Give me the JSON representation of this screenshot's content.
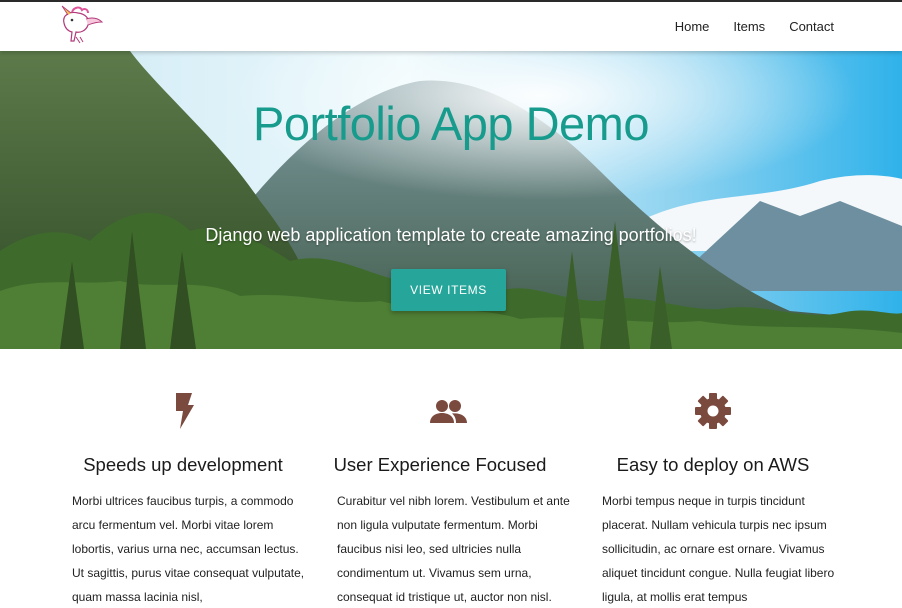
{
  "navbar": {
    "logo_icon": "unicorn-logo-icon",
    "links": [
      "Home",
      "Items",
      "Contact"
    ]
  },
  "hero": {
    "title": "Portfolio App Demo",
    "subtitle": "Django web application template to create amazing portfolios!",
    "button_label": "VIEW ITEMS",
    "title_color": "#179b8c",
    "button_color": "#26a69a"
  },
  "features": [
    {
      "icon": "flash-icon",
      "title": "Speeds up development",
      "text": "Morbi ultrices faucibus turpis, a commodo arcu fermentum vel. Morbi vitae lorem lobortis, varius urna nec, accumsan lectus. Ut sagittis, purus vitae consequat vulputate, quam massa lacinia nisl,"
    },
    {
      "icon": "group-icon",
      "title": "User Experience Focused",
      "text": "Curabitur vel nibh lorem. Vestibulum et ante non ligula vulputate fermentum. Morbi faucibus nisi leo, sed ultricies nulla condimentum ut. Vivamus sem urna, consequat id tristique ut, auctor non nisl."
    },
    {
      "icon": "gear-icon",
      "title": "Easy to deploy on AWS",
      "text": "Morbi tempus neque in turpis tincidunt placerat. Nullam vehicula turpis nec ipsum sollicitudin, ac ornare est ornare. Vivamus aliquet tincidunt congue. Nulla feugiat libero ligula, at mollis erat tempus"
    }
  ],
  "icon_color": "#7b4a3e"
}
